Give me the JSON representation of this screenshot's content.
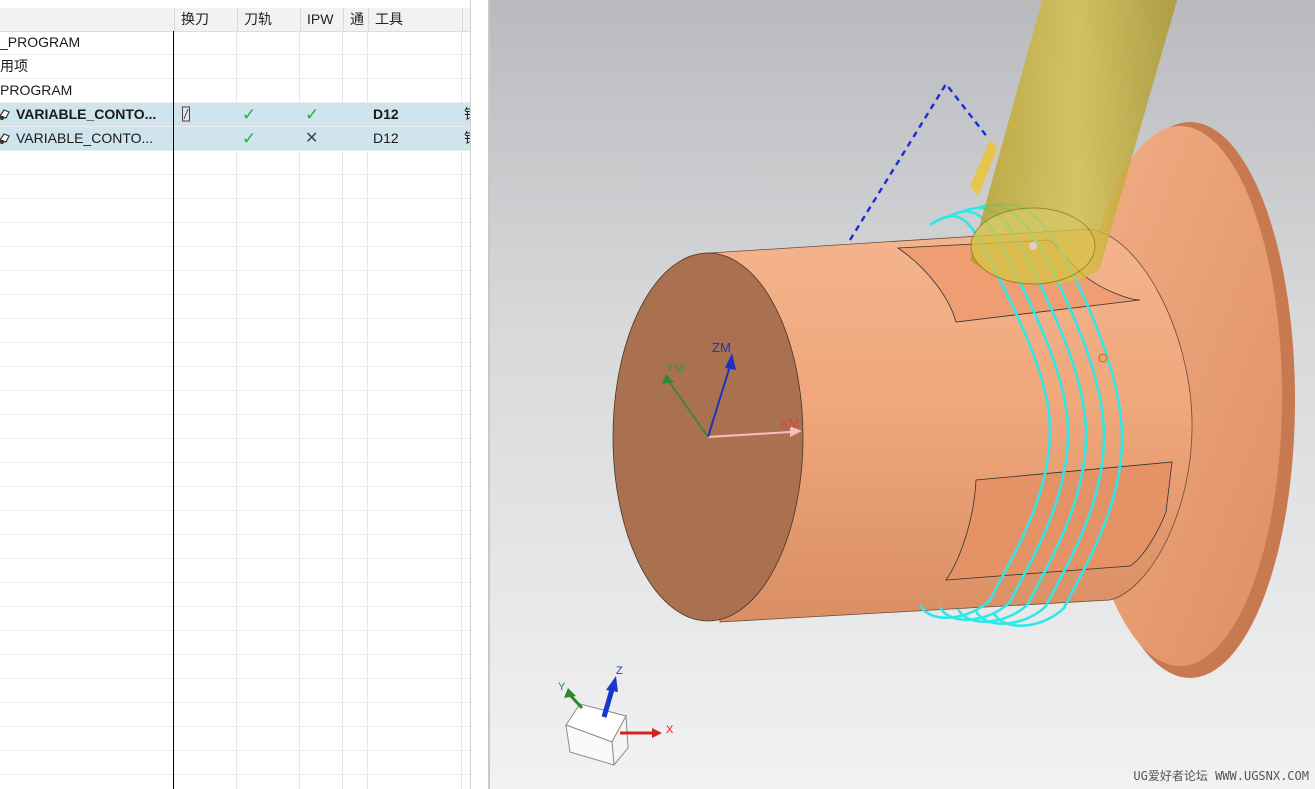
{
  "navigator": {
    "columns": [
      "换刀",
      "刀轨",
      "IPW",
      "通",
      "工具",
      ""
    ],
    "rows": [
      {
        "name": "_PROGRAM",
        "bold": false,
        "selected": false,
        "tool_change": "",
        "toolpath": "",
        "ipw": "",
        "tool": "",
        "extra": ""
      },
      {
        "name": "用项",
        "bold": false,
        "selected": false,
        "tool_change": "",
        "toolpath": "",
        "ipw": "",
        "tool": "",
        "extra": ""
      },
      {
        "name": "PROGRAM",
        "bold": false,
        "selected": false,
        "tool_change": "",
        "toolpath": "",
        "ipw": "",
        "tool": "",
        "extra": ""
      },
      {
        "name": "VARIABLE_CONTO...",
        "bold": true,
        "selected": true,
        "tool_change": "tool-change-icon",
        "toolpath": "✓",
        "ipw": "✓",
        "tool": "D12",
        "extra": "铣"
      },
      {
        "name": "VARIABLE_CONTO...",
        "bold": false,
        "selected": true,
        "tool_change": "",
        "toolpath": "✓",
        "ipw": "✕",
        "tool": "D12",
        "extra": "铣"
      }
    ],
    "empty_rows": 26
  },
  "viewport": {
    "axis_labels": {
      "wcs_x": "XM",
      "wcs_y": "YM",
      "wcs_z": "ZM",
      "triad_x": "X",
      "triad_y": "Y",
      "triad_z": "Z"
    },
    "watermark": "UG爱好者论坛 WWW.UGSNX.COM",
    "colors": {
      "part": "#e9a07a",
      "toolpath": "#2ee8e8",
      "tool": "#c8b22f"
    }
  }
}
